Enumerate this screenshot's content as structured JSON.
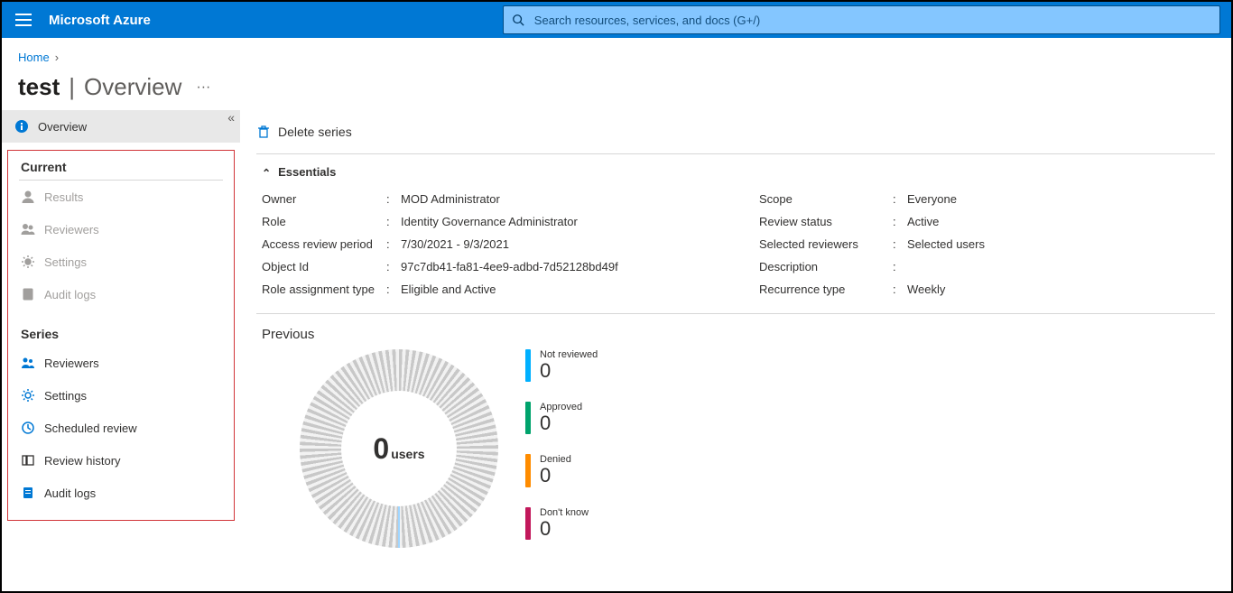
{
  "brand": "Microsoft Azure",
  "search": {
    "placeholder": "Search resources, services, and docs (G+/)"
  },
  "breadcrumb": {
    "home": "Home"
  },
  "title": {
    "name": "test",
    "page": "Overview"
  },
  "toolbar": {
    "delete_series": "Delete series"
  },
  "sidebar": {
    "overview": "Overview",
    "current_header": "Current",
    "series_header": "Series",
    "current": [
      {
        "label": "Results",
        "icon": "person-icon"
      },
      {
        "label": "Reviewers",
        "icon": "people-icon"
      },
      {
        "label": "Settings",
        "icon": "gear-icon"
      },
      {
        "label": "Audit logs",
        "icon": "log-icon"
      }
    ],
    "series": [
      {
        "label": "Reviewers",
        "icon": "people-icon",
        "color": "#0078d4"
      },
      {
        "label": "Settings",
        "icon": "gear-icon",
        "color": "#0078d4"
      },
      {
        "label": "Scheduled review",
        "icon": "clock-icon",
        "color": "#0078d4"
      },
      {
        "label": "Review history",
        "icon": "history-icon",
        "color": "#323130"
      },
      {
        "label": "Audit logs",
        "icon": "log-icon",
        "color": "#0078d4"
      }
    ]
  },
  "essentials_label": "Essentials",
  "essentials_left": {
    "owner": {
      "k": "Owner",
      "v": "MOD Administrator"
    },
    "role": {
      "k": "Role",
      "v": "Identity Governance Administrator"
    },
    "period": {
      "k": "Access review period",
      "v": "7/30/2021 - 9/3/2021"
    },
    "object": {
      "k": "Object Id",
      "v": "97c7db41-fa81-4ee9-adbd-7d52128bd49f"
    },
    "ratype": {
      "k": "Role assignment type",
      "v": "Eligible and Active"
    }
  },
  "essentials_right": {
    "scope": {
      "k": "Scope",
      "v": "Everyone"
    },
    "status": {
      "k": "Review status",
      "v": "Active"
    },
    "revsel": {
      "k": "Selected reviewers",
      "v": "Selected users"
    },
    "desc": {
      "k": "Description",
      "v": ""
    },
    "recur": {
      "k": "Recurrence type",
      "v": "Weekly"
    }
  },
  "previous_label": "Previous",
  "donut": {
    "value": "0",
    "unit": "users"
  },
  "legend": [
    {
      "label": "Not reviewed",
      "value": "0",
      "color": "#00b0ff"
    },
    {
      "label": "Approved",
      "value": "0",
      "color": "#00a36c"
    },
    {
      "label": "Denied",
      "value": "0",
      "color": "#ff8c00"
    },
    {
      "label": "Don't know",
      "value": "0",
      "color": "#c2185b"
    }
  ],
  "chart_data": {
    "type": "pie",
    "title": "Previous",
    "categories": [
      "Not reviewed",
      "Approved",
      "Denied",
      "Don't know"
    ],
    "values": [
      0,
      0,
      0,
      0
    ],
    "series_colors": [
      "#00b0ff",
      "#00a36c",
      "#ff8c00",
      "#c2185b"
    ],
    "center_label": "0 users",
    "total": 0
  }
}
